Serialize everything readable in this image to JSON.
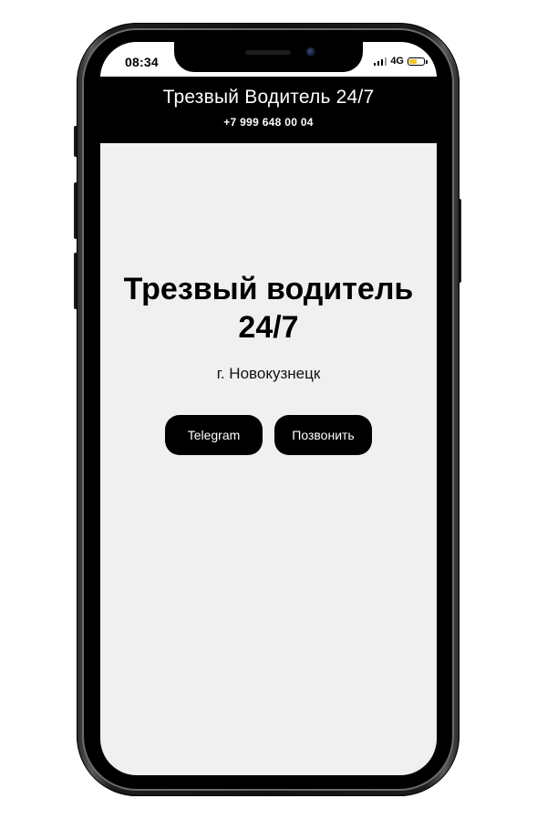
{
  "status_bar": {
    "time": "08:34",
    "network": "4G",
    "signal_icon": "cellular-signal-icon",
    "battery_icon": "battery-icon",
    "battery_level": 0.6,
    "battery_color": "#f3c623"
  },
  "header": {
    "title": "Трезвый Водитель 24/7",
    "phone": "+7 999 648 00 04"
  },
  "hero": {
    "title": "Трезвый водитель 24/7",
    "city": "г. Новокузнецк"
  },
  "buttons": {
    "telegram": "Telegram",
    "call": "Позвонить"
  },
  "colors": {
    "header_bg": "#000000",
    "page_bg": "#f0f0f0",
    "button_bg": "#000000",
    "button_text": "#ffffff"
  }
}
